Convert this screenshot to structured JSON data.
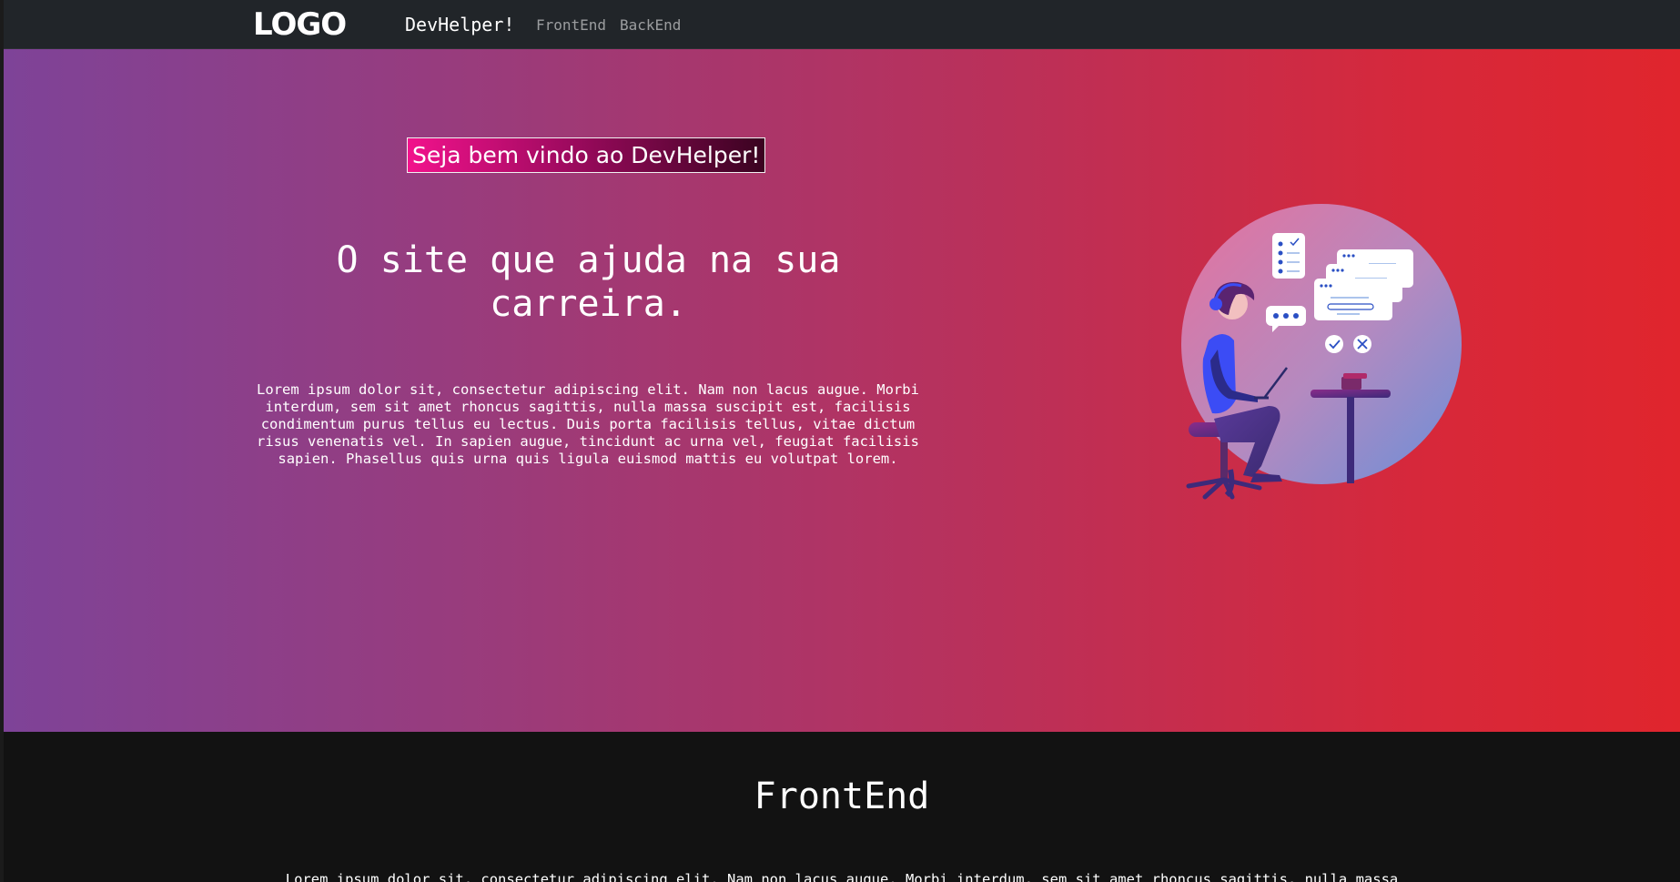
{
  "navbar": {
    "logo_text": "LOGO",
    "brand": "DevHelper!",
    "links": [
      {
        "label": "FrontEnd"
      },
      {
        "label": "BackEnd"
      }
    ],
    "background": "#212529"
  },
  "hero": {
    "welcome": "Seja bem vindo ao DevHelper!",
    "headline": "O site que ajuda na sua carreira.",
    "lead": "Lorem ipsum dolor sit, consectetur adipiscing elit. Nam non lacus augue. Morbi interdum, sem sit amet rhoncus sagittis, nulla massa suscipit est, facilisis condimentum purus tellus eu lectus. Duis porta facilisis tellus, vitae dictum risus venenatis vel. In sapien augue, tincidunt ac urna vel, feugiat facilisis sapien. Phasellus quis urna quis ligula euismod mattis eu volutpat lorem.",
    "illustration": "person-working-at-laptop-illustration",
    "gradient_start": "#7e4398",
    "gradient_end": "#e0252d"
  },
  "frontend_section": {
    "title": "FrontEnd",
    "text": "Lorem ipsum dolor sit, consectetur adipiscing elit. Nam non lacus augue. Morbi interdum, sem sit amet rhoncus sagittis, nulla massa",
    "background": "#121212"
  }
}
